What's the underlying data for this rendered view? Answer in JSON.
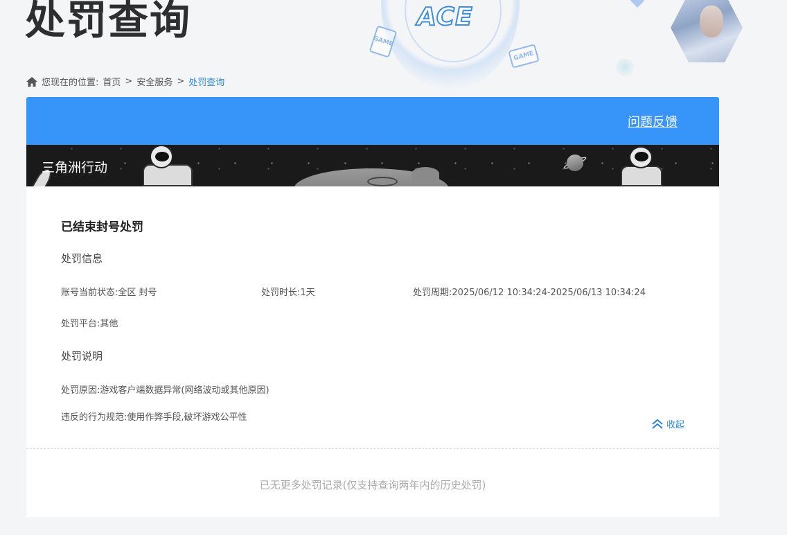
{
  "header": {
    "title": "处罚查询",
    "logo_text": "ACE",
    "card_left_text": "GAME",
    "card_right_text": "GAME"
  },
  "breadcrumb": {
    "prefix": "您现在的位置:",
    "items": [
      "首页",
      "安全服务",
      "处罚查询"
    ],
    "separator": ">"
  },
  "card": {
    "feedback_link": "问题反馈",
    "game_name": "三角洲行动",
    "ban_title": "已结束封号处罚",
    "info_section_title": "处罚信息",
    "status": "账号当前状态:全区 封号",
    "duration": "处罚时长:1天",
    "period": "处罚周期:2025/06/12 10:34:24-2025/06/13 10:34:24",
    "platform": "处罚平台:其他",
    "desc_section_title": "处罚说明",
    "reason": "处罚原因:游戏客户端数据异常(网络波动或其他原因)",
    "rule": "违反的行为规范:使用作弊手段,破坏游戏公平性",
    "collapse_label": "收起",
    "footer_note": "已无更多处罚记录(仅支持查询两年内的历史处罚)"
  },
  "colors": {
    "accent_blue": "#3794f8",
    "link_blue": "#2f86d6",
    "page_bg": "#f4f5f7"
  }
}
